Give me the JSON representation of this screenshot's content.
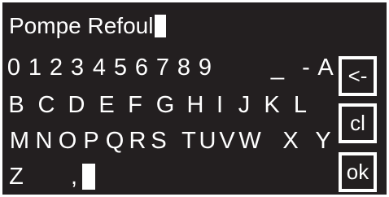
{
  "entry": {
    "text": "Pompe Refoul"
  },
  "keyboard": {
    "row1": [
      "0",
      "1",
      "2",
      "3",
      "4",
      "5",
      "6",
      "7",
      "8",
      "9",
      "_",
      "-",
      "A"
    ],
    "row2": [
      "B",
      "C",
      "D",
      "E",
      "F",
      "G",
      "H",
      "I",
      "J",
      "K",
      "L"
    ],
    "row3": [
      "M",
      "N",
      "O",
      "P",
      "Q",
      "R",
      "S",
      "T",
      "U",
      "V",
      "W",
      "X",
      "Y"
    ],
    "row4": [
      "Z",
      ","
    ]
  },
  "buttons": {
    "backspace": "<-",
    "clear": "cl",
    "ok": "ok"
  },
  "colors": {
    "background": "#231f20",
    "foreground": "#ffffff"
  }
}
